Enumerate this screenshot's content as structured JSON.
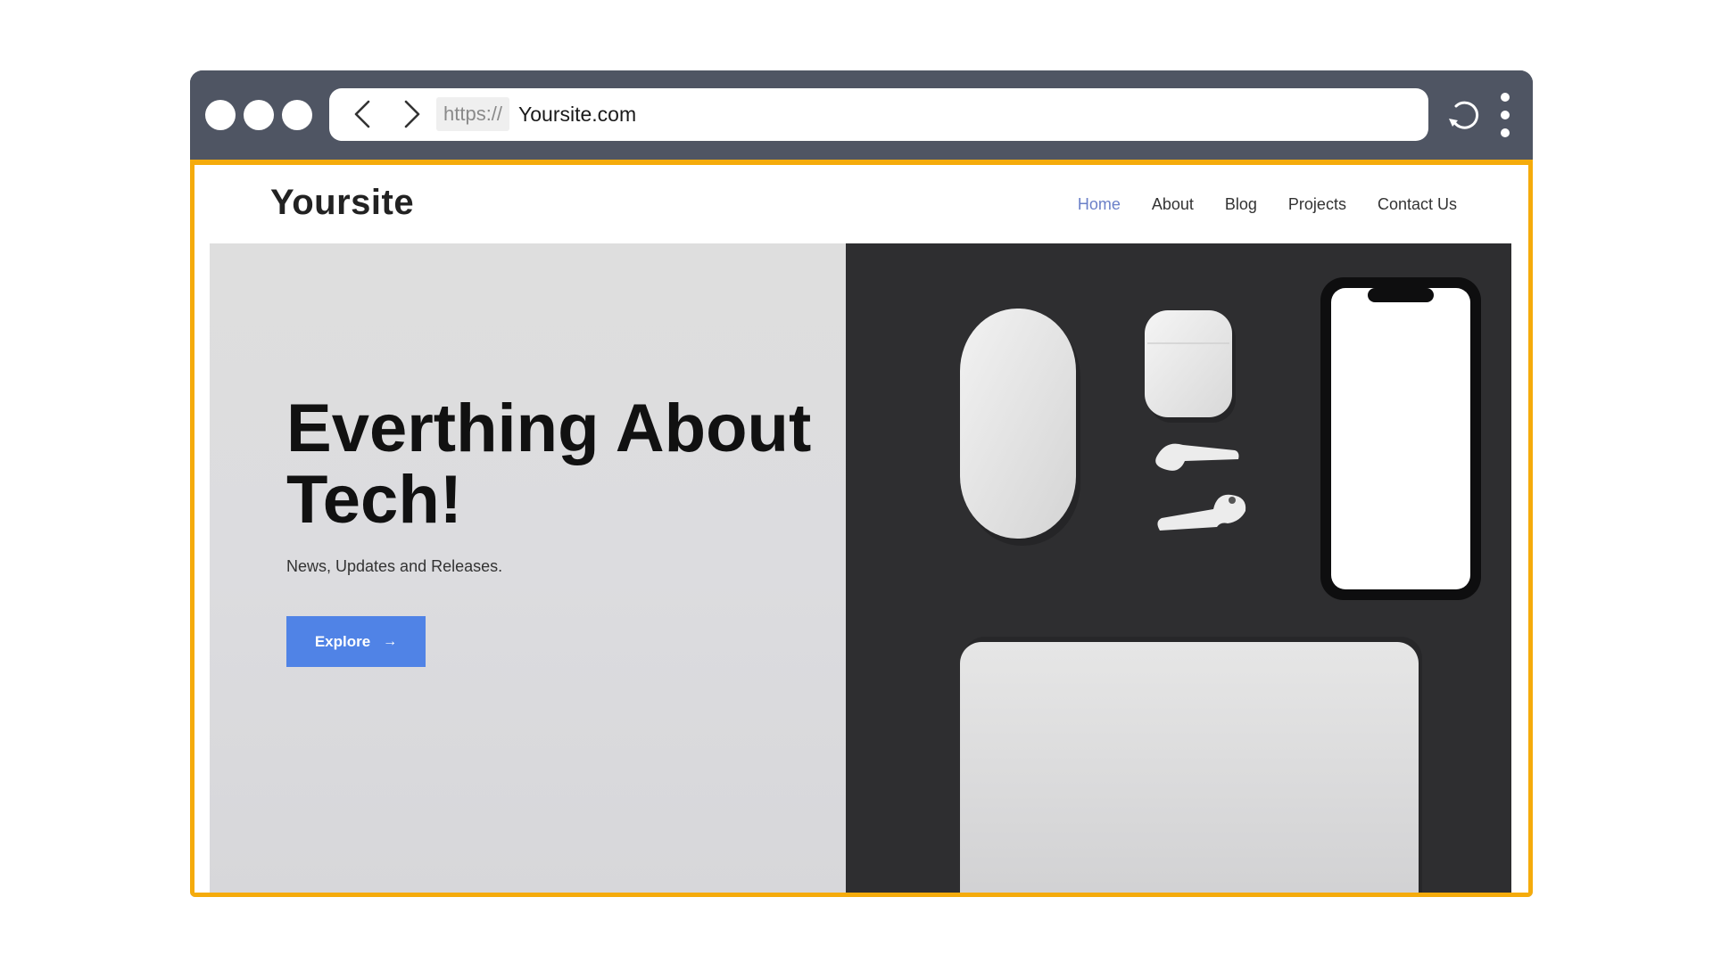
{
  "browser": {
    "protocol": "https://",
    "address": "Yoursite.com"
  },
  "site": {
    "logo": "Yoursite",
    "nav": [
      {
        "label": "Home",
        "active": true
      },
      {
        "label": "About",
        "active": false
      },
      {
        "label": "Blog",
        "active": false
      },
      {
        "label": "Projects",
        "active": false
      },
      {
        "label": "Contact Us",
        "active": false
      }
    ],
    "hero": {
      "title_line1": "Everthing About",
      "title_line2": "Tech!",
      "subtitle": "News, Updates and Releases.",
      "cta_label": "Explore",
      "cta_icon": "arrow-right-icon"
    }
  },
  "colors": {
    "frame": "#4f5563",
    "highlight_border": "#f5ab0b",
    "nav_active": "#6b80c8",
    "button": "#5083e6",
    "hero_dark": "#2e2e30"
  },
  "icons": [
    "back-icon",
    "forward-icon",
    "reload-icon",
    "more-vertical-icon",
    "arrow-right-icon"
  ]
}
